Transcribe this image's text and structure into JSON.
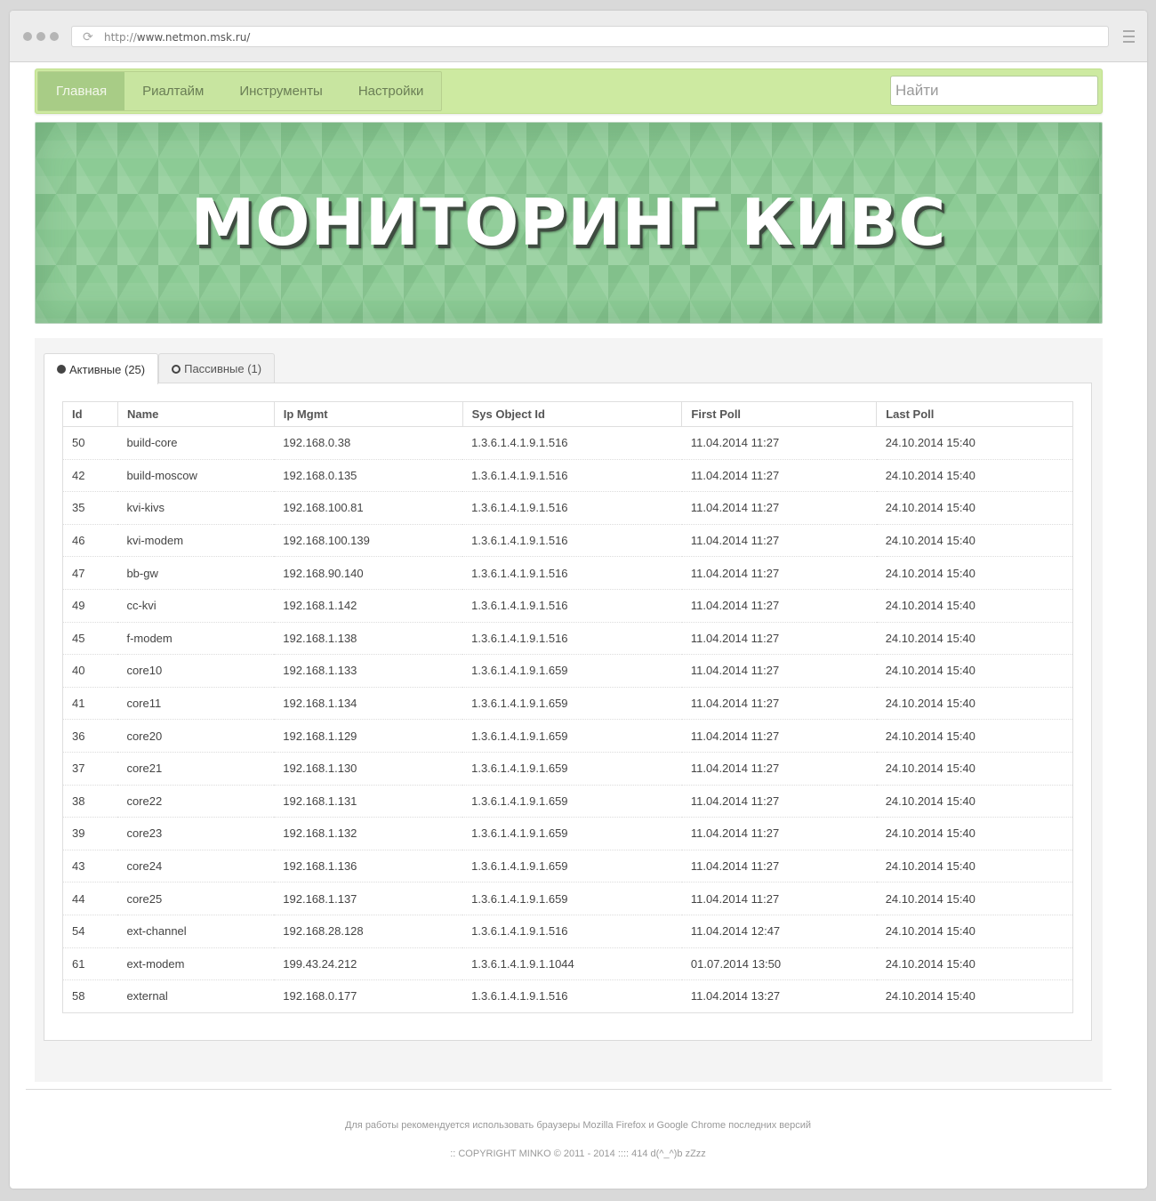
{
  "browser": {
    "url_prefix": "http://",
    "url_host": "www.netmon.msk.ru/"
  },
  "nav": {
    "items": [
      "Главная",
      "Риалтайм",
      "Инструменты",
      "Настройки"
    ],
    "active_index": 0,
    "search_placeholder": "Найти"
  },
  "banner": {
    "title": "МОНИТОРИНГ КИВС"
  },
  "tabs": [
    {
      "label": "Активные (25)",
      "active": true,
      "bullet": "filled-circle-icon"
    },
    {
      "label": "Пассивные (1)",
      "active": false,
      "bullet": "hollow-circle-icon"
    }
  ],
  "table": {
    "columns": [
      "Id",
      "Name",
      "Ip Mgmt",
      "Sys Object Id",
      "First Poll",
      "Last Poll"
    ],
    "rows": [
      [
        "50",
        "build-core",
        "192.168.0.38",
        "1.3.6.1.4.1.9.1.516",
        "11.04.2014 11:27",
        "24.10.2014 15:40"
      ],
      [
        "42",
        "build-moscow",
        "192.168.0.135",
        "1.3.6.1.4.1.9.1.516",
        "11.04.2014 11:27",
        "24.10.2014 15:40"
      ],
      [
        "35",
        "kvi-kivs",
        "192.168.100.81",
        "1.3.6.1.4.1.9.1.516",
        "11.04.2014 11:27",
        "24.10.2014 15:40"
      ],
      [
        "46",
        "kvi-modem",
        "192.168.100.139",
        "1.3.6.1.4.1.9.1.516",
        "11.04.2014 11:27",
        "24.10.2014 15:40"
      ],
      [
        "47",
        "bb-gw",
        "192.168.90.140",
        "1.3.6.1.4.1.9.1.516",
        "11.04.2014 11:27",
        "24.10.2014 15:40"
      ],
      [
        "49",
        "cc-kvi",
        "192.168.1.142",
        "1.3.6.1.4.1.9.1.516",
        "11.04.2014 11:27",
        "24.10.2014 15:40"
      ],
      [
        "45",
        "f-modem",
        "192.168.1.138",
        "1.3.6.1.4.1.9.1.516",
        "11.04.2014 11:27",
        "24.10.2014 15:40"
      ],
      [
        "40",
        "core10",
        "192.168.1.133",
        "1.3.6.1.4.1.9.1.659",
        "11.04.2014 11:27",
        "24.10.2014 15:40"
      ],
      [
        "41",
        "core11",
        "192.168.1.134",
        "1.3.6.1.4.1.9.1.659",
        "11.04.2014 11:27",
        "24.10.2014 15:40"
      ],
      [
        "36",
        "core20",
        "192.168.1.129",
        "1.3.6.1.4.1.9.1.659",
        "11.04.2014 11:27",
        "24.10.2014 15:40"
      ],
      [
        "37",
        "core21",
        "192.168.1.130",
        "1.3.6.1.4.1.9.1.659",
        "11.04.2014 11:27",
        "24.10.2014 15:40"
      ],
      [
        "38",
        "core22",
        "192.168.1.131",
        "1.3.6.1.4.1.9.1.659",
        "11.04.2014 11:27",
        "24.10.2014 15:40"
      ],
      [
        "39",
        "core23",
        "192.168.1.132",
        "1.3.6.1.4.1.9.1.659",
        "11.04.2014 11:27",
        "24.10.2014 15:40"
      ],
      [
        "43",
        "core24",
        "192.168.1.136",
        "1.3.6.1.4.1.9.1.659",
        "11.04.2014 11:27",
        "24.10.2014 15:40"
      ],
      [
        "44",
        "core25",
        "192.168.1.137",
        "1.3.6.1.4.1.9.1.659",
        "11.04.2014 11:27",
        "24.10.2014 15:40"
      ],
      [
        "54",
        "ext-channel",
        "192.168.28.128",
        "1.3.6.1.4.1.9.1.516",
        "11.04.2014 12:47",
        "24.10.2014 15:40"
      ],
      [
        "61",
        "ext-modem",
        "199.43.24.212",
        "1.3.6.1.4.1.9.1.1044",
        "01.07.2014 13:50",
        "24.10.2014 15:40"
      ],
      [
        "58",
        "external",
        "192.168.0.177",
        "1.3.6.1.4.1.9.1.516",
        "11.04.2014 13:27",
        "24.10.2014 15:40"
      ]
    ]
  },
  "footer": {
    "recommendation": "Для работы рекомендуется использовать браузеры Mozilla Firefox и Google Chrome последних версий",
    "copyright": ":: COPYRIGHT MINKO © 2011 - 2014 :::: 414 d(^_^)b zZzz"
  },
  "colors": {
    "navbar": "#cdeaa1",
    "nav_active": "#a8cc86",
    "banner": "#8ccb95"
  }
}
